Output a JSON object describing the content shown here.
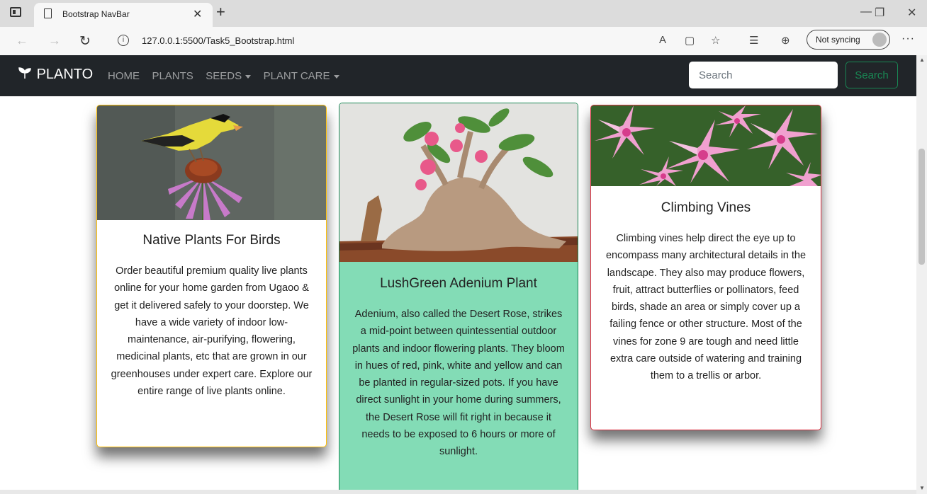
{
  "browser": {
    "tab_title": "Bootstrap NavBar",
    "url": "127.0.0.1:5500/Task5_Bootstrap.html",
    "sync_label": "Not syncing"
  },
  "navbar": {
    "brand": "PLANTO",
    "links": [
      "HOME",
      "PLANTS",
      "SEEDS",
      "PLANT CARE"
    ],
    "search_placeholder": "Search",
    "search_button": "Search"
  },
  "cards": [
    {
      "title": "Native Plants For Birds",
      "text": "Order beautiful premium quality live plants online for your home garden from Ugaoo & get it delivered safely to your doorstep. We have a wide variety of indoor low-maintenance, air-purifying, flowering, medicinal plants, etc that are grown in our greenhouses under expert care. Explore our entire range of live plants online."
    },
    {
      "title": "LushGreen Adenium Plant",
      "text": "Adenium, also called the Desert Rose, strikes a mid-point between quintessential outdoor plants and indoor flowering plants. They bloom in hues of red, pink, white and yellow and can be planted in regular-sized pots. If you have direct sunlight in your home during summers, the Desert Rose will fit right in because it needs to be exposed to 6 hours or more of sunlight."
    },
    {
      "title": "Climbing Vines",
      "text": "Climbing vines help direct the eye up to encompass many architectural details in the landscape. They also may produce flowers, fruit, attract butterflies or pollinators, feed birds, shade an area or simply cover up a failing fence or other structure. Most of the vines for zone 9 are tough and need little extra care outside of watering and training them to a trellis or arbor."
    }
  ]
}
